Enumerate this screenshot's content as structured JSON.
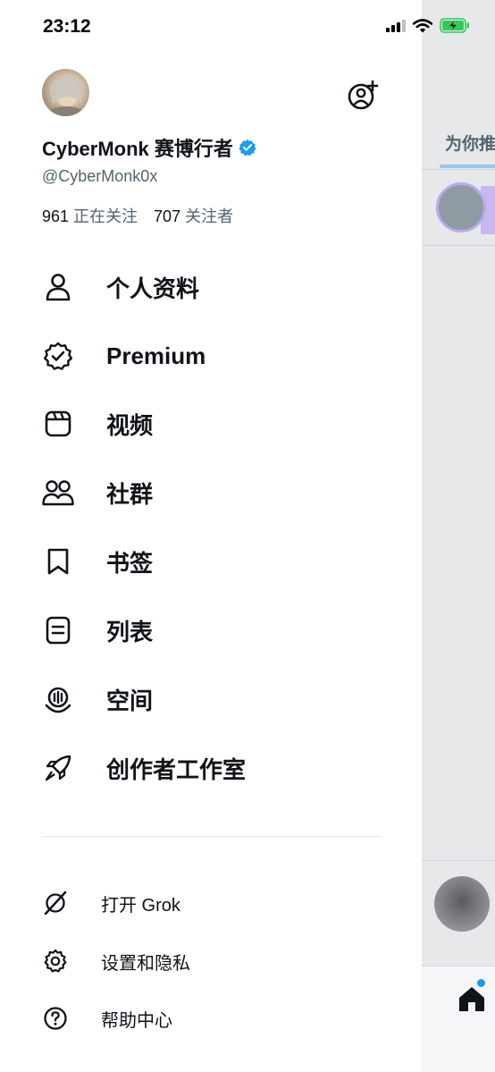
{
  "status_bar": {
    "time": "23:12"
  },
  "profile": {
    "display_name": "CyberMonk 赛博行者",
    "handle": "@CyberMonk0x",
    "following_count": "961",
    "following_label": "正在关注",
    "followers_count": "707",
    "followers_label": "关注者"
  },
  "menu": {
    "items": [
      {
        "label": "个人资料",
        "icon": "person-icon"
      },
      {
        "label": "Premium",
        "icon": "verified-badge-icon"
      },
      {
        "label": "视频",
        "icon": "video-icon"
      },
      {
        "label": "社群",
        "icon": "communities-icon"
      },
      {
        "label": "书签",
        "icon": "bookmark-icon"
      },
      {
        "label": "列表",
        "icon": "list-icon"
      },
      {
        "label": "空间",
        "icon": "spaces-icon"
      },
      {
        "label": "创作者工作室",
        "icon": "rocket-icon"
      }
    ],
    "secondary": [
      {
        "label": "打开 Grok",
        "icon": "grok-icon"
      },
      {
        "label": "设置和隐私",
        "icon": "gear-icon"
      },
      {
        "label": "帮助中心",
        "icon": "help-icon"
      }
    ]
  },
  "background": {
    "tab_label": "为你推"
  },
  "colors": {
    "verified": "#1d9bf0",
    "text": "#0f1419",
    "secondary_text": "#536471",
    "battery": "#34c759"
  }
}
